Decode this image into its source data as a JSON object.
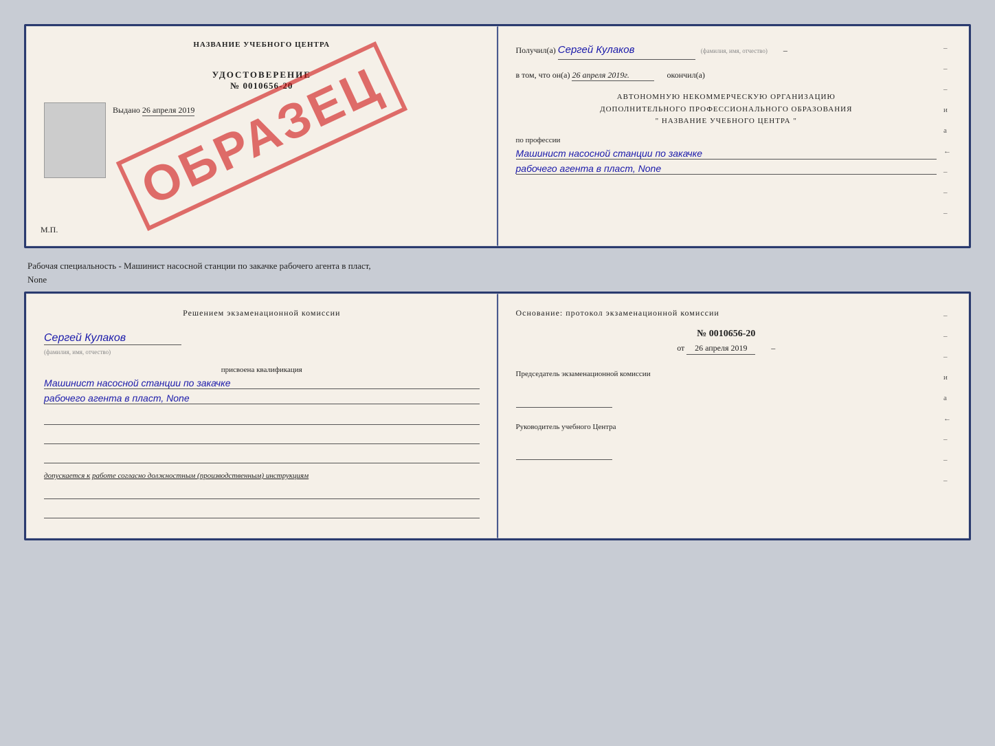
{
  "colors": {
    "background": "#c8ccd4",
    "bookSpine": "#2a3a6e",
    "pageBackground": "#f5f0e8",
    "textMain": "#222222",
    "textBlue": "#1a1aaa",
    "stampRed": "#cc0000"
  },
  "book1": {
    "leftPage": {
      "schoolName": "НАЗВАНИЕ УЧЕБНОГО ЦЕНТРА",
      "certTitle": "УДОСТОВЕРЕНИЕ",
      "certNumber": "№ 0010656-20",
      "issuedLabel": "Выдано",
      "issuedDate": "26 апреля 2019",
      "mpLabel": "М.П.",
      "stampText": "ОБРАЗЕЦ"
    },
    "rightPage": {
      "recipientLabel": "Получил(а)",
      "recipientName": "Сергей Кулаков",
      "recipientSubLabel": "(фамилия, имя, отчество)",
      "dateLabel": "в том, что он(а)",
      "dateValue": "26 апреля 2019г.",
      "finishedLabel": "окончил(а)",
      "orgLine1": "АВТОНОМНУЮ НЕКОММЕРЧЕСКУЮ ОРГАНИЗАЦИЮ",
      "orgLine2": "ДОПОЛНИТЕЛЬНОГО ПРОФЕССИОНАЛЬНОГО ОБРАЗОВАНИЯ",
      "orgLine3": "\" НАЗВАНИЕ УЧЕБНОГО ЦЕНТРА \"",
      "professionLabel": "по профессии",
      "professionLine1": "Машинист насосной станции по закачке",
      "professionLine2": "рабочего агента в пласт, None",
      "rightSideChars": [
        "-",
        "-",
        "-",
        "и",
        "а",
        "←",
        "-",
        "-",
        "-"
      ]
    }
  },
  "middleText": {
    "line1": "Рабочая специальность - Машинист насосной станции по закачке рабочего агента в пласт,",
    "line2": "None"
  },
  "book2": {
    "leftPage": {
      "commissionTitle": "Решением экзаменационной комиссии",
      "personName": "Сергей Кулаков",
      "personSubLabel": "(фамилия, имя, отчество)",
      "assignedText": "присвоена квалификация",
      "qualificationLine1": "Машинист насосной станции по закачке",
      "qualificationLine2": "рабочего агента в пласт, None",
      "допускаетсяPrefix": "допускается к",
      "допускаетсяText": "работе согласно должностным (производственным) инструкциям"
    },
    "rightPage": {
      "osnovanieTitle": "Основание: протокол экзаменационной комиссии",
      "protocolNumber": "№ 0010656-20",
      "protocolDatePrefix": "от",
      "protocolDate": "26 апреля 2019",
      "chairmanTitle": "Председатель экзаменационной комиссии",
      "rukovoditelTitle": "Руководитель учебного Центра",
      "rightSideChars": [
        "-",
        "-",
        "-",
        "и",
        "а",
        "←",
        "-",
        "-",
        "-"
      ]
    }
  }
}
